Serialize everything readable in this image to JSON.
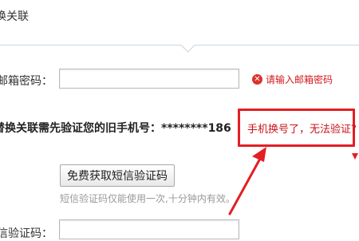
{
  "header": {
    "title": "换关联"
  },
  "email_row": {
    "label": "邮箱密码：",
    "input_value": "",
    "error_text": "请输入邮箱密码",
    "error_icon": "error-x-icon"
  },
  "verify_row": {
    "text": "替换关联需先验证您的旧手机号：********186"
  },
  "highlight": {
    "link_text": "手机换号了，无法验证？",
    "color": "#e31e24"
  },
  "sms": {
    "button_label": "免费获取短信验证码",
    "hint": "短信验证码仅能使用一次,十分钟内有效。"
  },
  "code_row": {
    "label": "信验证码：",
    "input_value": ""
  }
}
